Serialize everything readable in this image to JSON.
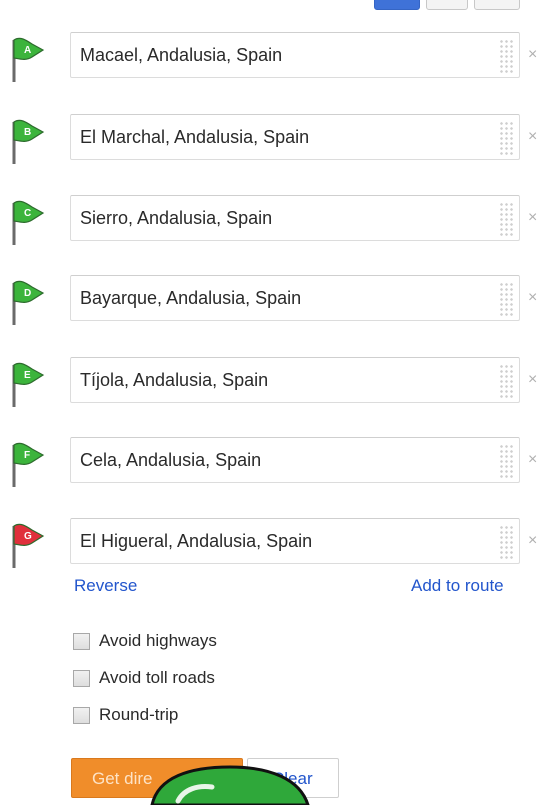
{
  "waypoints": [
    {
      "letter": "A",
      "value": "Macael, Andalusia, Spain",
      "color": "#3cb43c",
      "remove": "×"
    },
    {
      "letter": "B",
      "value": "El Marchal, Andalusia, Spain",
      "color": "#3cb43c",
      "remove": "×"
    },
    {
      "letter": "C",
      "value": "Sierro, Andalusia, Spain",
      "color": "#3cb43c",
      "remove": "×"
    },
    {
      "letter": "D",
      "value": "Bayarque, Andalusia, Spain",
      "color": "#3cb43c",
      "remove": "×"
    },
    {
      "letter": "E",
      "value": "Tíjola, Andalusia, Spain",
      "color": "#3cb43c",
      "remove": "×"
    },
    {
      "letter": "F",
      "value": "Cela, Andalusia, Spain",
      "color": "#3cb43c",
      "remove": "×"
    },
    {
      "letter": "G",
      "value": "El Higueral, Andalusia, Spain",
      "color": "#e0303c",
      "remove": "×"
    }
  ],
  "links": {
    "reverse": "Reverse",
    "add_to_route": "Add to route"
  },
  "options": [
    {
      "label": "Avoid highways",
      "checked": false
    },
    {
      "label": "Avoid toll roads",
      "checked": false
    },
    {
      "label": "Round-trip",
      "checked": false
    }
  ],
  "buttons": {
    "get_directions": "Get dire",
    "clear": "Clear"
  },
  "colors": {
    "link": "#2255cc",
    "primary_button": "#f08d2a",
    "start_flag": "#3cb43c",
    "end_flag": "#e0303c"
  }
}
